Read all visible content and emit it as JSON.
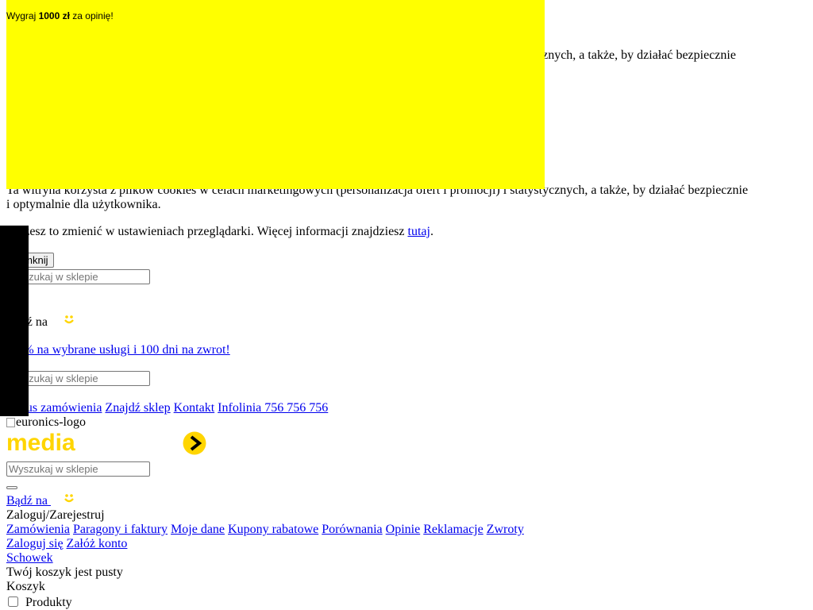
{
  "banner": {
    "prefix": "Wygraj ",
    "amount": "1000 zł",
    "suffix": " za opinię!",
    "color": "#ffff00"
  },
  "cookie": {
    "top_visible": "ycznych, a także, by działać bezpiecznie",
    "main_text": "Ta witryna korzysta z plików cookies w celach marketingowych (personalizacja ofert i promocji) i statystycznych, a także, by działać bezpiecznie i optymalnie dla użytkownika.",
    "settings_text": "Możesz to zmienić w ustawieniach przeglądarki. Więcej informacji znajdziesz ",
    "link": "tutaj",
    "period": ".",
    "close_label": "Zamknij"
  },
  "search": {
    "placeholder": "Wyszukaj w sklepie"
  },
  "promo1": {
    "prefix": "Bądź na"
  },
  "promo_link": "-10% na wybrane usługi i 100 dni na zwrot!",
  "top_links": {
    "order_status": "Status zamówienia",
    "find_store": "Znajdź sklep",
    "contact": "Kontakt",
    "hotline": "Infolinia 756 756 756"
  },
  "logo_alt": "euronics-logo",
  "media_logo_text": "media",
  "brand_color": "#ffd500",
  "account": {
    "be_on": "Bądź na",
    "login_register": "Zaloguj/Zarejestruj",
    "links": [
      "Zamówienia",
      "Paragony i faktury",
      "Moje dane",
      "Kupony rabatowe",
      "Porównania",
      "Opinie",
      "Reklamacje",
      "Zwroty"
    ],
    "login": "Zaloguj się",
    "create_account": "Załóż konto",
    "wishlist": "Schowek"
  },
  "cart": {
    "empty": "Twój koszyk jest pusty",
    "label": "Koszyk",
    "products": "Produkty"
  }
}
